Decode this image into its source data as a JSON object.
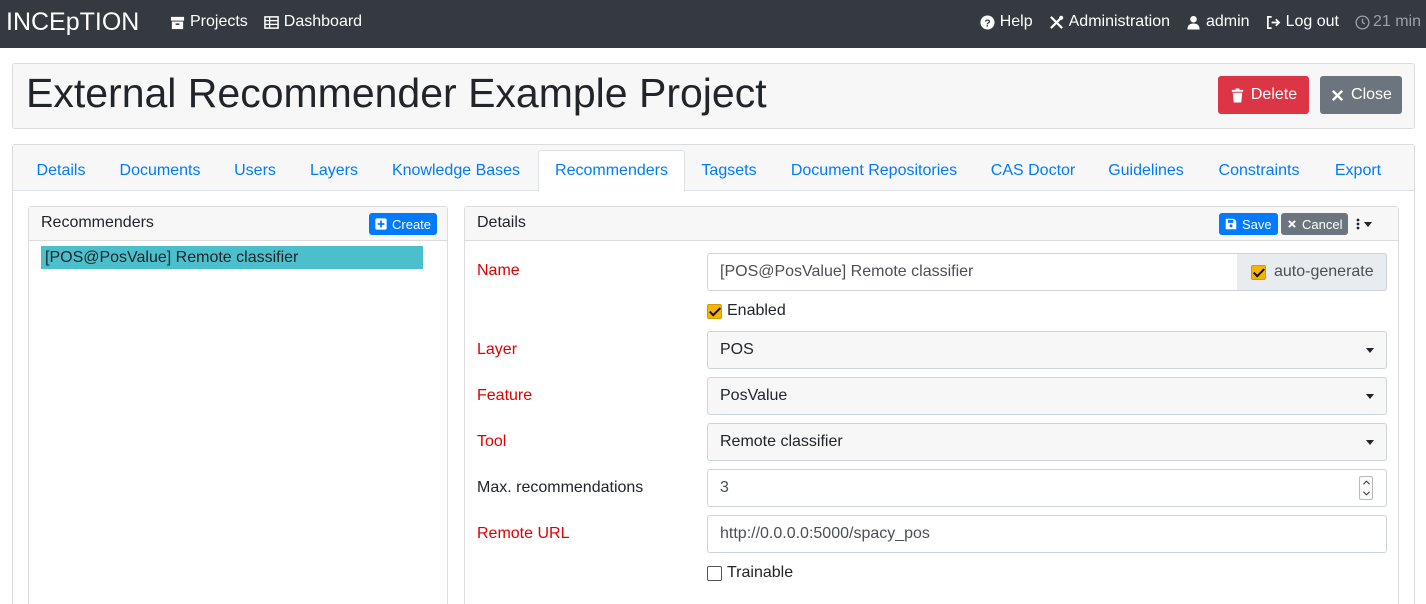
{
  "navbar": {
    "brand": "INCEpTION",
    "left": [
      {
        "label": "Projects",
        "icon": "archive-icon"
      },
      {
        "label": "Dashboard",
        "icon": "table-icon"
      }
    ],
    "right": [
      {
        "label": "Help",
        "icon": "question-circle-icon"
      },
      {
        "label": "Administration",
        "icon": "tools-icon"
      },
      {
        "label": "admin",
        "icon": "user-icon"
      },
      {
        "label": "Log out",
        "icon": "sign-out-icon"
      }
    ],
    "session": "21 min"
  },
  "project": {
    "title": "External Recommender Example Project",
    "delete_label": "Delete",
    "close_label": "Close"
  },
  "tabs": [
    {
      "label": "Details"
    },
    {
      "label": "Documents"
    },
    {
      "label": "Users"
    },
    {
      "label": "Layers"
    },
    {
      "label": "Knowledge Bases"
    },
    {
      "label": "Recommenders",
      "active": true
    },
    {
      "label": "Tagsets"
    },
    {
      "label": "Document Repositories"
    },
    {
      "label": "CAS Doctor"
    },
    {
      "label": "Guidelines"
    },
    {
      "label": "Constraints"
    },
    {
      "label": "Export"
    }
  ],
  "recommenders": {
    "title": "Recommenders",
    "create_label": "Create",
    "items": [
      "[POS@PosValue] Remote classifier"
    ]
  },
  "details": {
    "title": "Details",
    "save_label": "Save",
    "cancel_label": "Cancel",
    "name_label": "Name",
    "name_value": "[POS@PosValue] Remote classifier",
    "auto_generate_label": "auto-generate",
    "enabled_label": "Enabled",
    "layer_label": "Layer",
    "layer_value": "POS",
    "feature_label": "Feature",
    "feature_value": "PosValue",
    "tool_label": "Tool",
    "tool_value": "Remote classifier",
    "max_label": "Max. recommendations",
    "max_value": "3",
    "url_label": "Remote URL",
    "url_value": "http://0.0.0.0:5000/spacy_pos",
    "trainable_label": "Trainable"
  },
  "colors": {
    "navbar_bg": "#343a40",
    "danger": "#dc3545",
    "secondary": "#6c757d",
    "primary": "#007bff",
    "selected_item": "#4bbfcb",
    "required_label": "#e00000"
  }
}
